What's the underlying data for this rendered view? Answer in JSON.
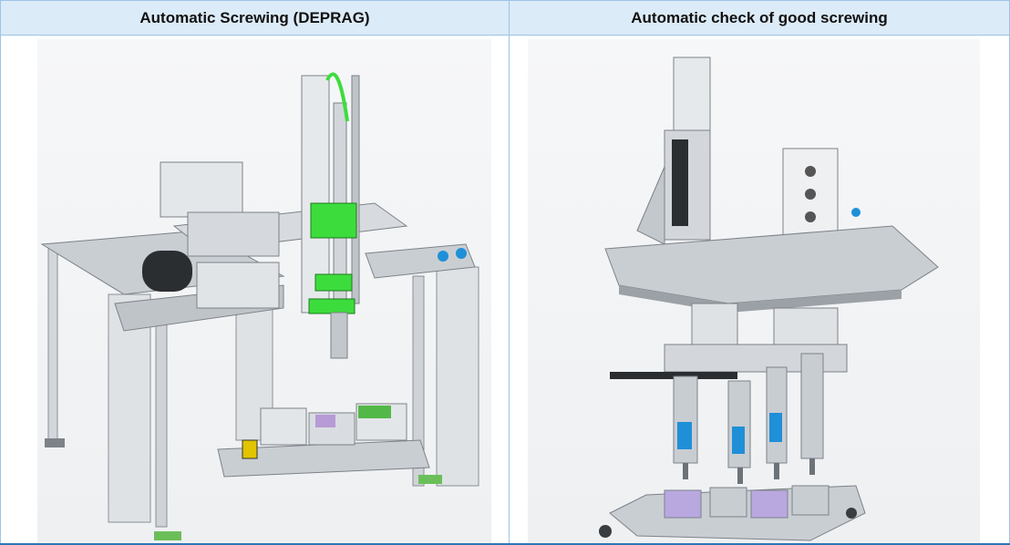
{
  "columns": [
    {
      "header": "Automatic Screwing (DEPRAG)",
      "image": "screwing-machine-render"
    },
    {
      "header": "Automatic check of good screwing",
      "image": "screw-check-station-render"
    }
  ],
  "colors": {
    "border": "#9dc3e6",
    "header_bg": "#dcebf8",
    "accent_green": "#3ddc3d",
    "accent_blue": "#1f8fd8",
    "metal": "#c9ced3"
  }
}
